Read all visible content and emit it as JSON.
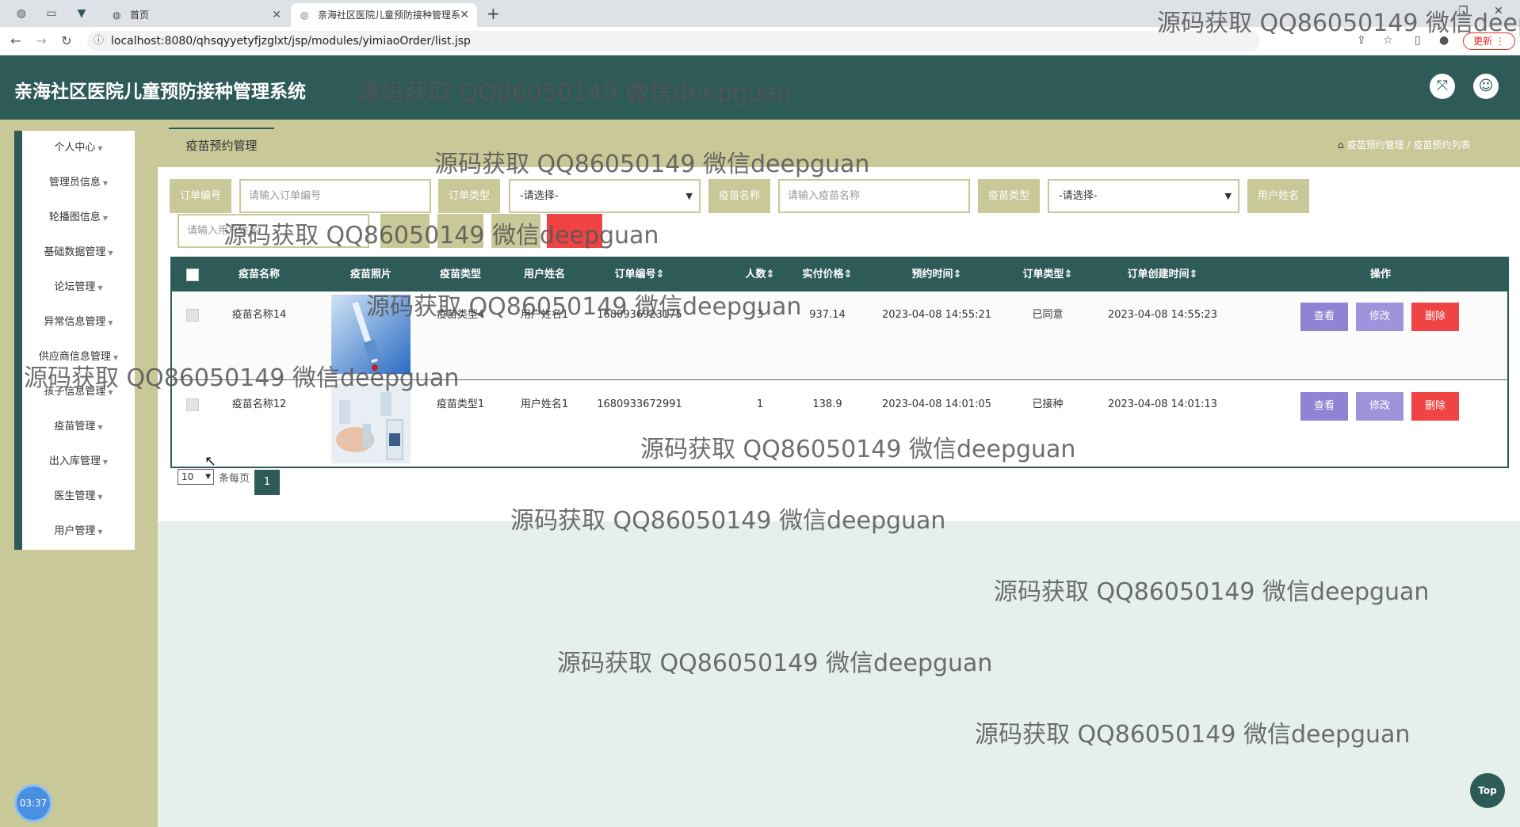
{
  "browser": {
    "tab_inactive": "首页",
    "tab_active": "亲海社区医院儿童预防接种管理系",
    "url": "localhost:8080/qhsqyyetyfjzglxt/jsp/modules/yimiaoOrder/list.jsp",
    "update_label": "更新"
  },
  "header": {
    "title": "亲海社区医院儿童预防接种管理系统"
  },
  "sidebar": {
    "items": [
      {
        "label": "个人中心"
      },
      {
        "label": "管理员信息"
      },
      {
        "label": "轮播图信息"
      },
      {
        "label": "基础数据管理"
      },
      {
        "label": "论坛管理"
      },
      {
        "label": "异常信息管理"
      },
      {
        "label": "供应商信息管理"
      },
      {
        "label": "孩子信息管理"
      },
      {
        "label": "疫苗管理"
      },
      {
        "label": "出入库管理"
      },
      {
        "label": "医生管理"
      },
      {
        "label": "用户管理"
      }
    ]
  },
  "page": {
    "section_title": "疫苗预约管理",
    "crumb_1": "疫苗预约管理",
    "crumb_sep": "/",
    "crumb_2": "疫苗预约列表"
  },
  "search": {
    "order_no_label": "订单编号",
    "order_no_placeholder": "请输入订单编号",
    "order_type_label": "订单类型",
    "order_type_value": "-请选择-",
    "vaccine_name_label": "疫苗名称",
    "vaccine_name_placeholder": "请输入疫苗名称",
    "vaccine_type_label": "疫苗类型",
    "vaccine_type_value": "-请选择-",
    "user_name_label": "用户姓名",
    "user_name_placeholder": "请输入用户姓名"
  },
  "table": {
    "headers": [
      "疫苗名称",
      "疫苗照片",
      "疫苗类型",
      "用户姓名",
      "订单编号⇕",
      "人数⇕",
      "实付价格⇕",
      "预约时间⇕",
      "订单类型⇕",
      "订单创建时间⇕",
      "操作"
    ],
    "rows": [
      {
        "name": "疫苗名称14",
        "type": "疫苗类型4",
        "user": "用户姓名1",
        "order_no": "1680936923175",
        "count": "3",
        "price": "937.14",
        "appt_time": "2023-04-08 14:55:21",
        "status": "已同意",
        "created": "2023-04-08 14:55:23"
      },
      {
        "name": "疫苗名称12",
        "type": "疫苗类型1",
        "user": "用户姓名1",
        "order_no": "1680933672991",
        "count": "1",
        "price": "138.9",
        "appt_time": "2023-04-08 14:01:05",
        "status": "已接种",
        "created": "2023-04-08 14:01:13"
      }
    ],
    "actions": {
      "view": "查看",
      "edit": "修改",
      "delete": "删除"
    }
  },
  "pager": {
    "page_size": "10",
    "per_page_label": "条每页",
    "current_page": "1"
  },
  "overlay": {
    "watermark": "源码获取 QQ86050149 微信deepguan",
    "watermark_cut": "源码获取 QQ86050149 微信deep",
    "clock": "03:37",
    "top_label": "Top"
  },
  "colors": {
    "primary": "#2e5a58",
    "khaki": "#c8c898",
    "danger": "#f04444",
    "purple": "#8f83d4"
  }
}
